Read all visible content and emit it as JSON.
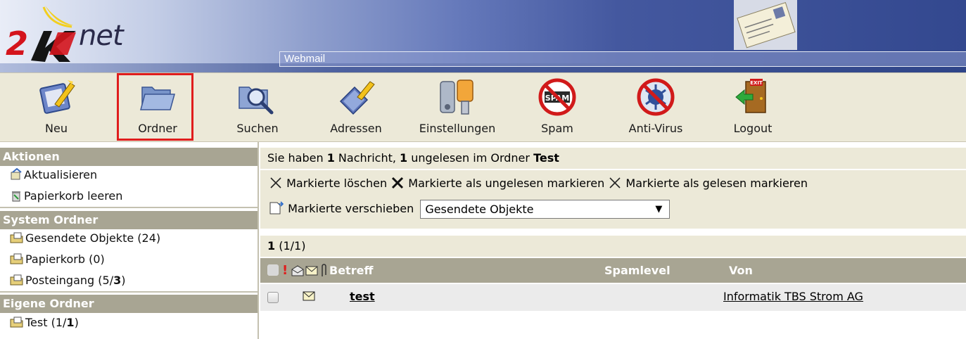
{
  "header": {
    "logo_text": "net",
    "section_title": "Webmail"
  },
  "toolbar": [
    {
      "label": "Neu",
      "icon": "compose-icon"
    },
    {
      "label": "Ordner",
      "icon": "folder-icon"
    },
    {
      "label": "Suchen",
      "icon": "search-icon"
    },
    {
      "label": "Adressen",
      "icon": "address-book-icon"
    },
    {
      "label": "Einstellungen",
      "icon": "settings-icon"
    },
    {
      "label": "Spam",
      "icon": "spam-icon"
    },
    {
      "label": "Anti-Virus",
      "icon": "antivirus-icon"
    },
    {
      "label": "Logout",
      "icon": "logout-icon"
    }
  ],
  "sidebar": {
    "actions_title": "Aktionen",
    "actions": [
      "Aktualisieren",
      "Papierkorb leeren"
    ],
    "system_title": "System Ordner",
    "system_folders": [
      {
        "name": "Gesendete Objekte",
        "count": "(24)"
      },
      {
        "name": "Papierkorb",
        "count": "(0)"
      },
      {
        "name": "Posteingang",
        "count_prefix": "(5/",
        "count_bold": "3",
        "count_suffix": ")"
      }
    ],
    "own_title": "Eigene Ordner",
    "own_folders": [
      {
        "name": "Test",
        "count_prefix": "(1/",
        "count_bold": "1",
        "count_suffix": ")"
      }
    ]
  },
  "main": {
    "info": {
      "prefix": "Sie haben ",
      "count": "1",
      "mid1": " Nachricht, ",
      "unread": "1",
      "mid2": " ungelesen im Ordner ",
      "folder": "Test"
    },
    "actions": {
      "delete": "Markierte löschen",
      "mark_unread": "Markierte als ungelesen markieren",
      "mark_read": "Markierte als gelesen markieren",
      "move": "Markierte verschieben",
      "move_target": "Gesendete Objekte"
    },
    "pager": {
      "current": "1",
      "range": "(1/1)"
    },
    "columns": {
      "subject": "Betreff",
      "spamlevel": "Spamlevel",
      "from": "Von"
    },
    "messages": [
      {
        "subject": "test",
        "spamlevel": "",
        "from": "Informatik TBS Strom AG"
      }
    ]
  }
}
